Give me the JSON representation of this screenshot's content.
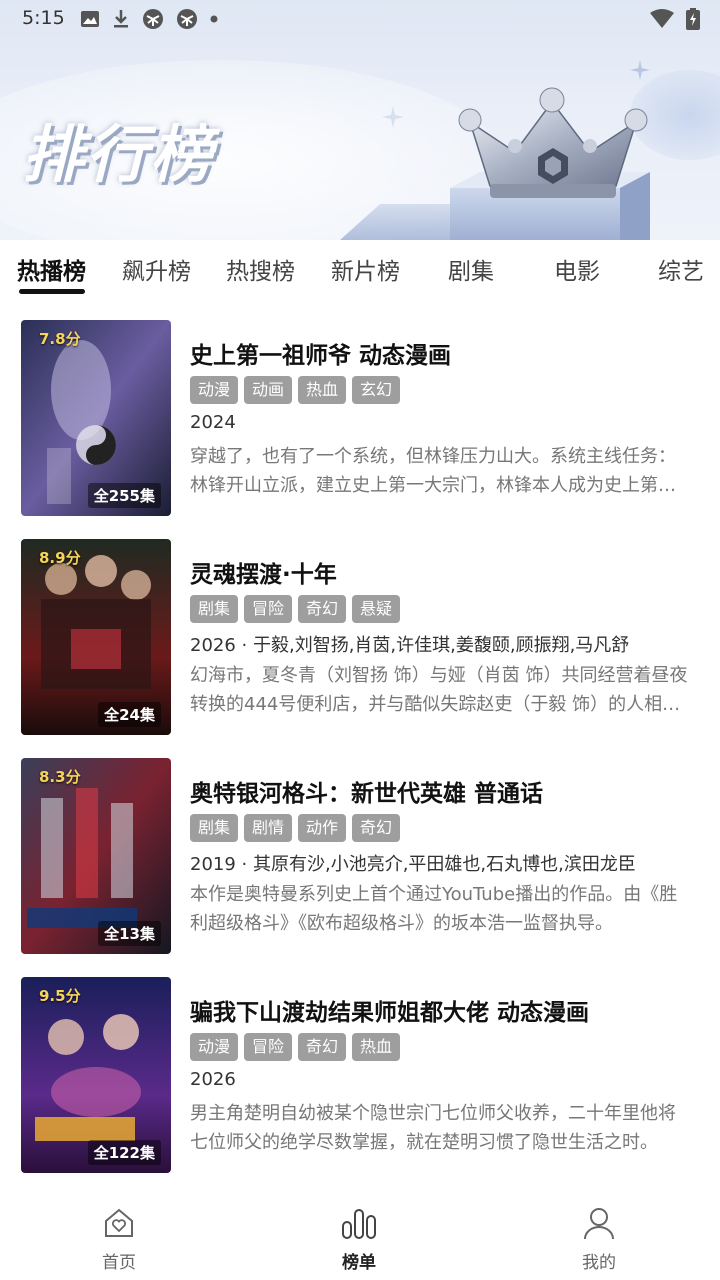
{
  "status_bar": {
    "time": "5:15",
    "left_icons": [
      "image-icon",
      "download-icon",
      "vpn-icon",
      "vpn-icon",
      "dot-icon"
    ],
    "right_icons": [
      "wifi-icon",
      "battery-charging-icon"
    ]
  },
  "header": {
    "title": "排行榜",
    "crown_icon": "crown-icon"
  },
  "tabs": [
    {
      "label": "热播榜",
      "active": true
    },
    {
      "label": "飙升榜",
      "active": false
    },
    {
      "label": "热搜榜",
      "active": false
    },
    {
      "label": "新片榜",
      "active": false
    },
    {
      "label": "剧集",
      "active": false
    },
    {
      "label": "电影",
      "active": false
    },
    {
      "label": "综艺",
      "active": false
    }
  ],
  "items": [
    {
      "score": "7.8分",
      "episodes": "全255集",
      "title": "史上第一祖师爷 动态漫画",
      "tags": [
        "动漫",
        "动画",
        "热血",
        "玄幻"
      ],
      "meta": "2024",
      "description": "穿越了，也有了一个系统，但林锋压力山大。系统主线任务：林锋开山立派，建立史上第一大宗门，林锋本人成为史上第一祖师爷。"
    },
    {
      "score": "8.9分",
      "episodes": "全24集",
      "title": "灵魂摆渡·十年",
      "tags": [
        "剧集",
        "冒险",
        "奇幻",
        "悬疑"
      ],
      "meta": "2026 · 于毅,刘智扬,肖茵,许佳琪,姜馥颐,顾振翔,马凡舒",
      "description": "幻海市，夏冬青（刘智扬 饰）与娅（肖茵 饰）共同经营着昼夜转换的444号便利店，并与酷似失踪赵吏（于毅 饰）的人相遇。"
    },
    {
      "score": "8.3分",
      "episodes": "全13集",
      "title": "奥特银河格斗：新世代英雄 普通话",
      "tags": [
        "剧集",
        "剧情",
        "动作",
        "奇幻"
      ],
      "meta": "2019 · 其原有沙,小池亮介,平田雄也,石丸博也,滨田龙臣",
      "description": "本作是奥特曼系列史上首个通过YouTube播出的作品。由《胜利超级格斗》《欧布超级格斗》的坂本浩一监督执导。"
    },
    {
      "score": "9.5分",
      "episodes": "全122集",
      "title": "骗我下山渡劫结果师姐都大佬 动态漫画",
      "tags": [
        "动漫",
        "冒险",
        "奇幻",
        "热血"
      ],
      "meta": "2026",
      "description": "男主角楚明自幼被某个隐世宗门七位师父收养，二十年里他将七位师父的绝学尽数掌握，就在楚明习惯了隐世生活之时。"
    }
  ],
  "bottom_nav": [
    {
      "label": "首页",
      "icon": "home-heart-icon",
      "active": false
    },
    {
      "label": "榜单",
      "icon": "chart-bars-icon",
      "active": true
    },
    {
      "label": "我的",
      "icon": "user-icon",
      "active": false
    }
  ],
  "colors": {
    "tag_bg": "#9e9e9e",
    "score": "#f6d45a",
    "active_tab": "#111111"
  }
}
